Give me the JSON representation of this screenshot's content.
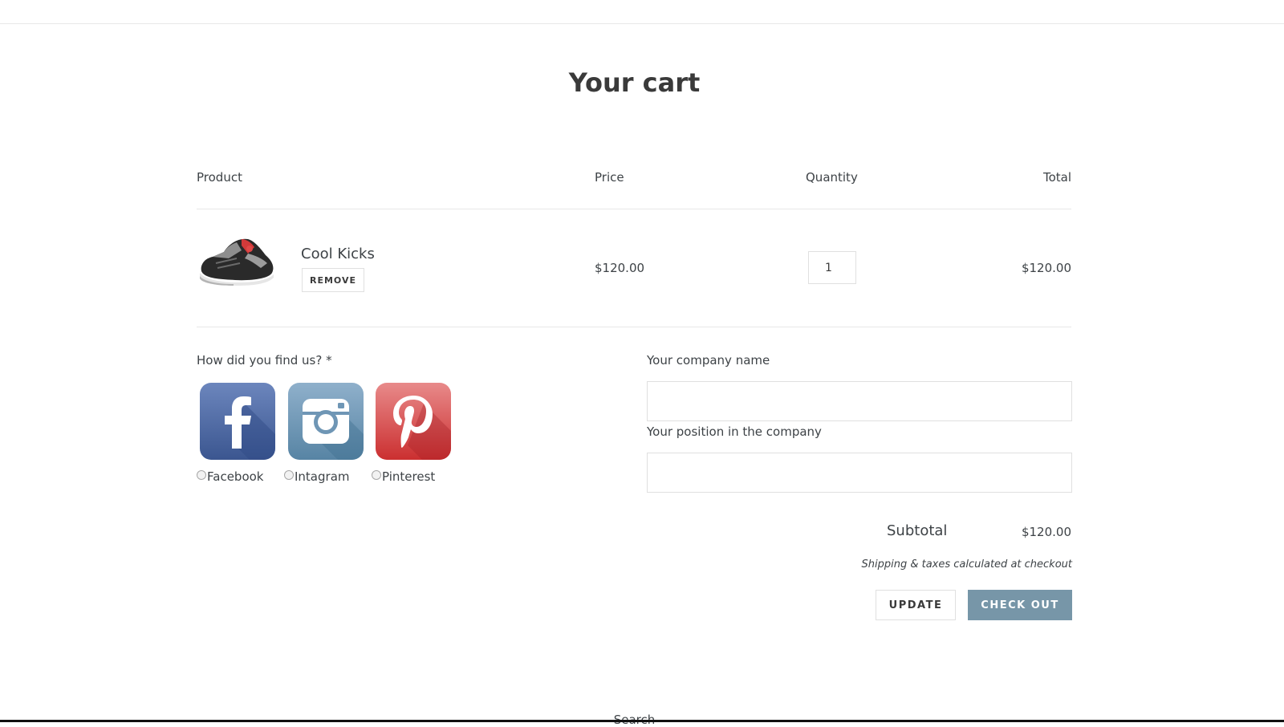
{
  "page": {
    "title": "Your cart"
  },
  "columns": {
    "product": "Product",
    "price": "Price",
    "quantity": "Quantity",
    "total": "Total"
  },
  "item": {
    "name": "Cool Kicks",
    "remove_label": "REMOVE",
    "price": "$120.00",
    "quantity": "1",
    "total": "$120.00",
    "image_icon": "sneaker-image"
  },
  "survey": {
    "label": "How did you find us? *",
    "options": [
      {
        "label": "Facebook",
        "icon": "facebook-icon",
        "color": "#3b5998"
      },
      {
        "label": "Intagram",
        "icon": "instagram-icon",
        "color": "#5b86a8"
      },
      {
        "label": "Pinterest",
        "icon": "pinterest-icon",
        "color": "#cb2027"
      }
    ]
  },
  "company": {
    "name_label": "Your company name",
    "name_value": "",
    "position_label": "Your position in the company",
    "position_value": ""
  },
  "summary": {
    "subtotal_label": "Subtotal",
    "subtotal_value": "$120.00",
    "shipping_note": "Shipping & taxes calculated at checkout"
  },
  "actions": {
    "update_label": "UPDATE",
    "checkout_label": "CHECK OUT"
  },
  "footer": {
    "search_label": "Search"
  },
  "colors": {
    "accent": "#7796a8",
    "text": "#3d4246",
    "border": "#e0e0e0"
  }
}
